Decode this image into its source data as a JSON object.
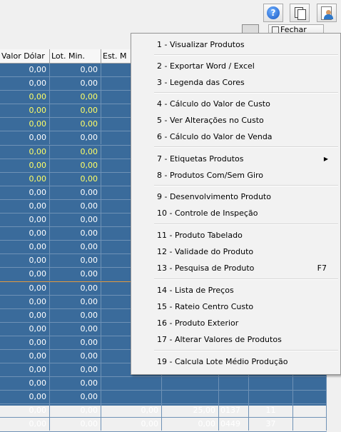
{
  "toolbar": {
    "help_glyph": "?",
    "fechar_label": "Fechar"
  },
  "grid": {
    "headers": [
      "Valor Dólar",
      "Lot. Min.",
      "Est. M"
    ],
    "rows": [
      {
        "a": "0,00",
        "b": "0,00",
        "yellow": false
      },
      {
        "a": "0,00",
        "b": "0,00",
        "yellow": false
      },
      {
        "a": "0,00",
        "b": "0,00",
        "yellow": true
      },
      {
        "a": "0,00",
        "b": "0,00",
        "yellow": true
      },
      {
        "a": "0,00",
        "b": "0,00",
        "yellow": true
      },
      {
        "a": "0,00",
        "b": "0,00",
        "yellow": false
      },
      {
        "a": "0,00",
        "b": "0,00",
        "yellow": true
      },
      {
        "a": "0,00",
        "b": "0,00",
        "yellow": true
      },
      {
        "a": "0,00",
        "b": "0,00",
        "yellow": true
      },
      {
        "a": "0,00",
        "b": "0,00",
        "yellow": false
      },
      {
        "a": "0,00",
        "b": "0,00",
        "yellow": false
      },
      {
        "a": "0,00",
        "b": "0,00",
        "yellow": false
      },
      {
        "a": "0,00",
        "b": "0,00",
        "yellow": false
      },
      {
        "a": "0,00",
        "b": "0,00",
        "yellow": false
      },
      {
        "a": "0,00",
        "b": "0,00",
        "yellow": false
      },
      {
        "a": "0,00",
        "b": "0,00",
        "yellow": false
      },
      {
        "a": "0,00",
        "b": "0,00",
        "yellow": false
      },
      {
        "a": "0,00",
        "b": "0,00",
        "yellow": false
      },
      {
        "a": "0,00",
        "b": "0,00",
        "yellow": false
      },
      {
        "a": "0,00",
        "b": "0,00",
        "yellow": false
      },
      {
        "a": "0,00",
        "b": "0,00",
        "yellow": false
      },
      {
        "a": "0,00",
        "b": "0,00",
        "yellow": false
      },
      {
        "a": "0,00",
        "b": "0,00",
        "yellow": false
      },
      {
        "a": "0,00",
        "b": "0,00",
        "yellow": false
      },
      {
        "a": "0,00",
        "b": "0,00",
        "yellow": false
      },
      {
        "a": "0,00",
        "b": "0,00",
        "c": "0,00",
        "d": "25,00",
        "e": "0137",
        "f": "11",
        "yellow": false
      },
      {
        "a": "0,00",
        "b": "0,00",
        "c": "0,00",
        "d": "0,00",
        "e": "0449",
        "f": "37",
        "yellow": false
      }
    ]
  },
  "menu": {
    "items": [
      {
        "label": "1 - Visualizar Produtos"
      },
      {
        "label": "2 - Exportar Word / Excel"
      },
      {
        "label": "3 - Legenda das Cores"
      },
      {
        "label": "4 - Cálculo do Valor de Custo"
      },
      {
        "label": "5 - Ver Alterações no Custo"
      },
      {
        "label": "6 - Cálculo do Valor de Venda"
      },
      {
        "label": "7 - Etiquetas Produtos",
        "submenu": true
      },
      {
        "label": "8 - Produtos Com/Sem Giro"
      },
      {
        "label": "9 - Desenvolvimento Produto"
      },
      {
        "label": "10 - Controle de Inspeção"
      },
      {
        "label": "11 - Produto Tabelado"
      },
      {
        "label": "12 - Validade do Produto"
      },
      {
        "label": "13 - Pesquisa de Produto",
        "shortcut": "F7"
      },
      {
        "label": "14 - Lista de Preços"
      },
      {
        "label": "15 - Rateio Centro Custo"
      },
      {
        "label": "16 - Produto Exterior"
      },
      {
        "label": "17 - Alterar Valores de Produtos"
      },
      {
        "label": "19 - Calcula Lote Médio Produção"
      }
    ]
  }
}
